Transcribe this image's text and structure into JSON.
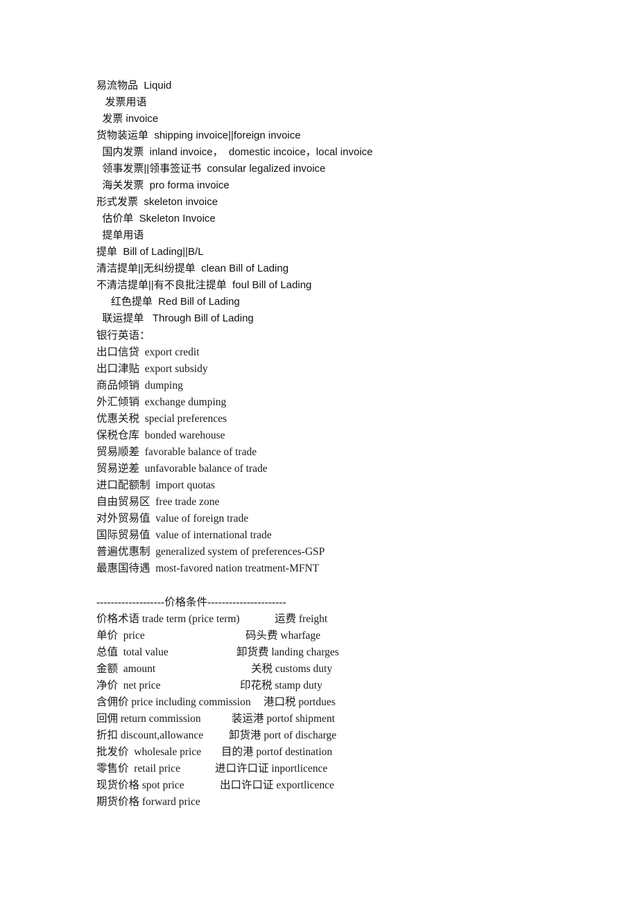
{
  "section1": {
    "lines": [
      {
        "text": "易流物品  Liquid"
      },
      {
        "text": "   发票用语"
      },
      {
        "text": "  发票 invoice"
      },
      {
        "text": "货物装运单  shipping invoice||foreign invoice"
      },
      {
        "text": "  国内发票  inland invoice，  domestic incoice，local invoice"
      },
      {
        "text": "  领事发票||领事签证书  consular legalized invoice"
      },
      {
        "text": "  海关发票  pro forma invoice"
      },
      {
        "text": "形式发票  skeleton invoice"
      },
      {
        "text": "  估价单  Skeleton Invoice"
      },
      {
        "text": "  提单用语"
      },
      {
        "text": "提单  Bill of Lading||B/L"
      },
      {
        "text": "清洁提单||无纠纷提单  clean Bill of Lading"
      },
      {
        "text": "不清洁提单||有不良批注提单  foul Bill of Lading"
      },
      {
        "text": "     红色提单  Red Bill of Lading"
      },
      {
        "text": "  联运提单   Through Bill of Lading"
      }
    ]
  },
  "section2": {
    "heading": "银行英语：",
    "lines": [
      {
        "text": "出口信贷  export credit"
      },
      {
        "text": "出口津贴  export subsidy"
      },
      {
        "text": "商品倾销  dumping"
      },
      {
        "text": "外汇倾销  exchange dumping"
      },
      {
        "text": "优惠关税  special preferences"
      },
      {
        "text": "保税仓库  bonded warehouse"
      },
      {
        "text": "贸易顺差  favorable balance of trade"
      },
      {
        "text": "贸易逆差  unfavorable balance of trade"
      },
      {
        "text": "进口配额制  import quotas"
      },
      {
        "text": "自由贸易区  free trade zone"
      },
      {
        "text": "对外贸易值  value of foreign trade"
      },
      {
        "text": "国际贸易值  value of international trade"
      },
      {
        "text": "普遍优惠制  generalized system of preferences-GSP"
      },
      {
        "text": "最惠国待遇  most-favored nation treatment-MFNT"
      }
    ]
  },
  "section3": {
    "heading": "-------------------价格条件----------------------",
    "rows": [
      {
        "left": "价格术语 trade term (price term)",
        "right": "运费 freight"
      },
      {
        "left": "单价  price",
        "right": "码头费 wharfage"
      },
      {
        "left": "总值  total value",
        "right": "卸货费 landing charges"
      },
      {
        "left": "金额  amount",
        "right": "关税 customs duty"
      },
      {
        "left": "净价  net price",
        "right": "印花税 stamp duty"
      },
      {
        "left": "含佣价 price including commission",
        "right": "港口税 portdues"
      },
      {
        "left": "回佣 return commission",
        "right": "装运港 portof shipment"
      },
      {
        "left": "折扣 discount,allowance",
        "right": "卸货港 port of discharge"
      },
      {
        "left": "批发价  wholesale price",
        "right": "目的港 portof destination"
      },
      {
        "left": "零售价  retail price",
        "right": "进口许口证 inportlicence"
      },
      {
        "left": "现货价格 spot price",
        "right": "出口许口证 exportlicence"
      },
      {
        "left": "期货价格 forward price",
        "right": ""
      }
    ]
  }
}
